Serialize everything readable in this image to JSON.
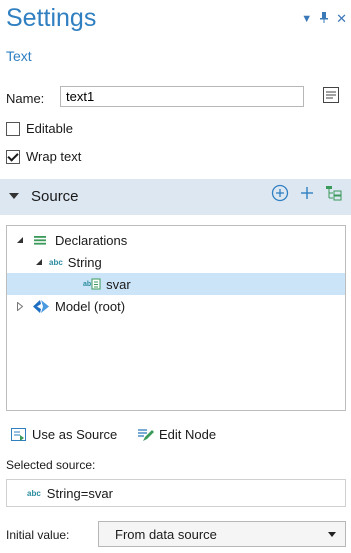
{
  "header": {
    "title": "Settings",
    "subtitle": "Text"
  },
  "window_controls": {
    "menu_glyph": "▾",
    "pin_glyph": "⊥",
    "close_glyph": "✕"
  },
  "form": {
    "name_label": "Name:",
    "name_value": "text1",
    "editable_label": "Editable",
    "editable_checked": false,
    "wrap_label": "Wrap text",
    "wrap_checked": true
  },
  "source_section": {
    "title": "Source",
    "tree": [
      {
        "label": "Declarations",
        "icon": "declarations-icon",
        "expanded": true
      },
      {
        "label": "String",
        "icon": "abc-icon",
        "expanded": true
      },
      {
        "label": "svar",
        "icon": "string-variable-icon",
        "selected": true
      },
      {
        "label": "Model (root)",
        "icon": "model-icon",
        "expanded": false
      }
    ],
    "use_as_source_label": "Use as Source",
    "edit_node_label": "Edit Node",
    "selected_source_label": "Selected source:",
    "selected_source_icon_text": "abc",
    "selected_source_value": "String=svar",
    "initial_value_label": "Initial value:",
    "initial_value_selected": "From data source"
  },
  "colors": {
    "accent": "#2f7fc1",
    "section_bg": "#dde7f2",
    "selected_row": "#cce4f7",
    "icon_green": "#3a9a5a",
    "abc_teal": "#2b8c9e"
  }
}
